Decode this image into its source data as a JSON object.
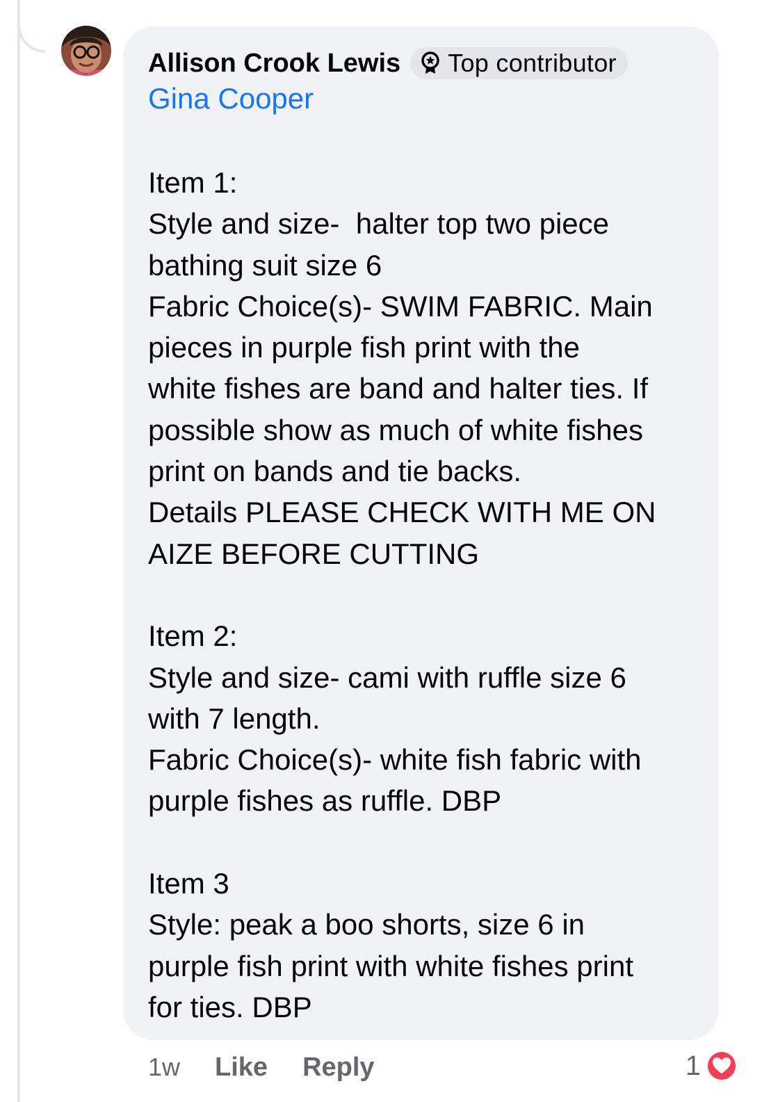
{
  "comment": {
    "author": "Allison Crook Lewis",
    "badge": {
      "icon": "top-contributor-badge-icon",
      "label": "Top contributor"
    },
    "mention": "Gina Cooper",
    "lines": [
      "Item 1:",
      "Style and size-  halter top two piece",
      "bathing suit size 6",
      "Fabric Choice(s)- SWIM FABRIC. Main",
      "pieces in purple fish print with the",
      "white fishes are band and halter ties. If",
      "possible show as much of white fishes",
      "print on bands and tie backs.",
      "Details PLEASE CHECK WITH ME ON",
      "AIZE BEFORE CUTTING",
      "",
      "Item 2:",
      "Style and size- cami with ruffle size 6",
      "with 7 length.",
      "Fabric Choice(s)- white fish fabric with",
      "purple fishes as ruffle. DBP",
      "",
      "Item 3",
      "Style: peak a boo shorts, size 6 in",
      "purple fish print with white fishes print",
      "for ties. DBP"
    ]
  },
  "actions": {
    "time": "1w",
    "like": "Like",
    "reply": "Reply"
  },
  "reactions": {
    "count": "1",
    "icon": "heart-reaction-icon",
    "color": "#f33e58"
  },
  "colors": {
    "bubble": "#f0f2f5",
    "link": "#1876f2",
    "secondary_text": "#65676b"
  }
}
